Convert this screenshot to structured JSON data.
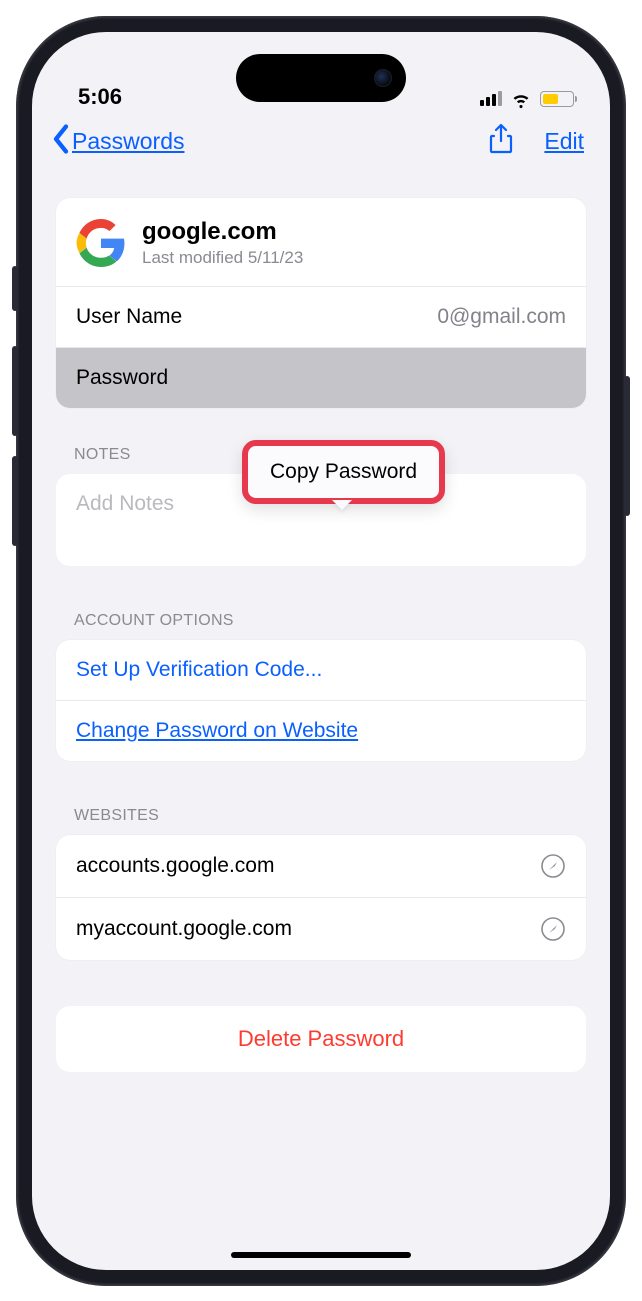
{
  "status": {
    "time": "5:06"
  },
  "nav": {
    "back": "Passwords",
    "edit": "Edit"
  },
  "site": {
    "domain": "google.com",
    "modified": "Last modified 5/11/23"
  },
  "fields": {
    "username_label": "User Name",
    "username_value": "0@gmail.com",
    "password_label": "Password"
  },
  "popup": {
    "copy": "Copy Password"
  },
  "sections": {
    "notes": "NOTES",
    "notes_placeholder": "Add Notes",
    "account_options": "ACCOUNT OPTIONS",
    "websites": "WEBSITES"
  },
  "account_options": {
    "verify": "Set Up Verification Code...",
    "change": "Change Password on Website"
  },
  "websites": {
    "w1": "accounts.google.com",
    "w2": "myaccount.google.com"
  },
  "delete_label": "Delete Password"
}
